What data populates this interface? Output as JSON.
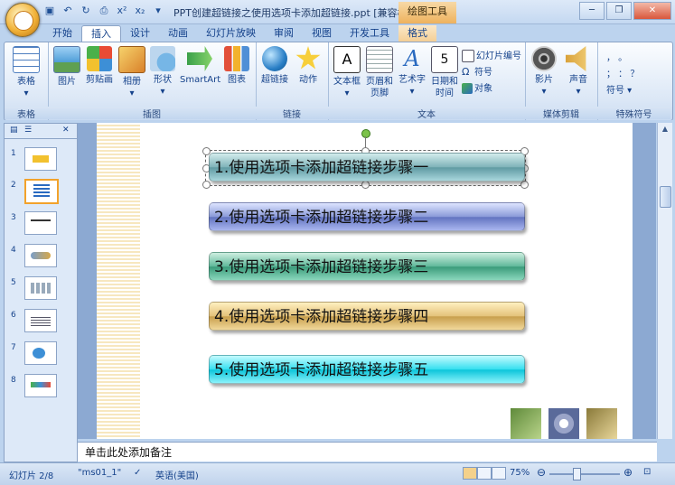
{
  "titlebar": {
    "doc_title": "PPT创建超链接之使用选项卡添加超链接.ppt [兼容模...",
    "context_tool": "绘图工具",
    "qat_icons": [
      "save-icon",
      "undo-icon",
      "redo-icon",
      "print-preview-icon",
      "superscript-icon",
      "subscript-icon",
      "customize-icon"
    ],
    "qat_glyphs": [
      "▣",
      "↶",
      "↻",
      "⎙",
      "x²",
      "x₂",
      "▾"
    ],
    "window_buttons": [
      "─",
      "❐",
      "✕"
    ]
  },
  "tabs": [
    "开始",
    "插入",
    "设计",
    "动画",
    "幻灯片放映",
    "审阅",
    "视图",
    "开发工具",
    "格式"
  ],
  "active_tab": "插入",
  "ribbon": {
    "groups": [
      {
        "label": "表格",
        "buttons": [
          {
            "label": "表格",
            "sub": "▾"
          }
        ]
      },
      {
        "label": "插图",
        "buttons": [
          {
            "label": "图片"
          },
          {
            "label": "剪贴画"
          },
          {
            "label": "相册",
            "sub": "▾"
          },
          {
            "label": "形状",
            "sub": "▾"
          },
          {
            "label": "SmartArt"
          },
          {
            "label": "图表"
          }
        ]
      },
      {
        "label": "链接",
        "buttons": [
          {
            "label": "超链接"
          },
          {
            "label": "动作"
          }
        ]
      },
      {
        "label": "文本",
        "buttons": [
          {
            "label": "文本框",
            "sub": "▾"
          },
          {
            "label": "页眉和",
            "sub": "页脚"
          },
          {
            "label": "艺术字",
            "sub": "▾"
          },
          {
            "label": "日期和",
            "sub": "时间"
          }
        ],
        "small": [
          "幻灯片编号",
          "符号",
          "对象"
        ]
      },
      {
        "label": "媒体剪辑",
        "buttons": [
          {
            "label": "影片",
            "sub": "▾"
          },
          {
            "label": "声音",
            "sub": "▾"
          }
        ]
      },
      {
        "label": "特殊符号",
        "small": [
          "，  。",
          "；  ：  ？",
          "符号 ▾"
        ]
      }
    ]
  },
  "slides_panel": {
    "numbers": [
      "1",
      "2",
      "3",
      "4",
      "5",
      "6",
      "7",
      "8"
    ],
    "selected": "2",
    "close": "✕"
  },
  "slide": {
    "steps": [
      "1.使用选项卡添加超链接步骤一",
      "2.使用选项卡添加超链接步骤二",
      "3.使用选项卡添加超链接步骤三",
      "4.使用选项卡添加超链接步骤四",
      "5.使用选项卡添加超链接步骤五"
    ]
  },
  "notes_placeholder": "单击此处添加备注",
  "status": {
    "slide_info": "幻灯片 2/8",
    "theme": "\"ms01_1\"",
    "language": "英语(美国)",
    "zoom": "75%",
    "zoom_out": "⊖",
    "zoom_in": "⊕"
  },
  "colors": {
    "ribbon_blue": "#15428b",
    "accent_orange": "#f2a22b"
  }
}
